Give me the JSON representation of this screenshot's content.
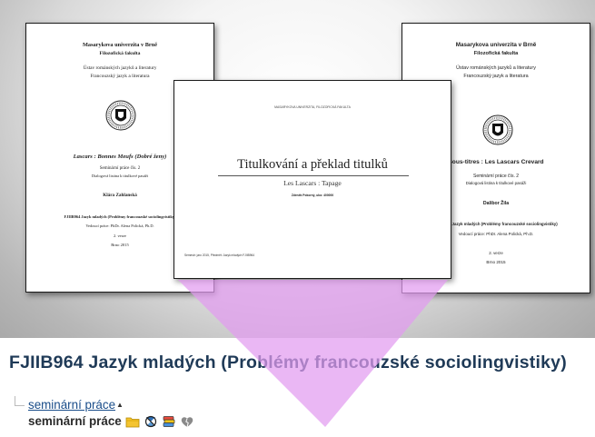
{
  "banner": {
    "left_page": {
      "university": "Masarykova univerzita v Brně",
      "faculty": "Filozofická fakulta",
      "institute": "Ústav románských jazyků a literatury",
      "program": "Francouzský jazyk a literatura",
      "title": "Lascars : Bonnes Meufs (Dobré ženy)",
      "work_type": "Seminární práce čís. 2",
      "subtitle": "Dialogová listina k titulkové pasáži",
      "author": "Klára Zahlanská",
      "course": "FJIIB964 Jazyk mladých (Problémy francouzské sociolingvistiky)",
      "supervisor": "Vedoucí práce: PhDr. Alena Polická, Ph.D.",
      "version": "2. verze",
      "place_date": "Brno 2015"
    },
    "right_page": {
      "university": "Masarykova univerzita v Brně",
      "faculty": "Filozofická fakulta",
      "institute": "Ústav románských jazyků a literatury",
      "program": "Francouzský jazyk a literatura",
      "title": "Sous-titres : Les Lascars Crevard",
      "work_type": "Seminární práce čís. 2",
      "subtitle": "Dialogová listina k titulkové pasáži",
      "author": "Dalibor Žila",
      "course": "FJIIB964 Jazyk mladých (Problémy francouzské sociolingvistiky)",
      "supervisor": "Vedoucí práce: PhDr. Alena Polická, Ph.D.",
      "version": "2. verze",
      "place_date": "Brno 2015"
    },
    "center_page": {
      "header": "MASARYKOVA UNIVERZITA, FILOZOFICKÁ FAKULTA",
      "title": "Titulkování a překlad titulků",
      "subtitle": "Les Lascars : Tapage",
      "author": "Zdeněk Pokorný, uko: 400000",
      "footer": "Semestr: jaro 2015, Předmět: Jazyk mladých FJIIB964"
    }
  },
  "course_heading": "FJIIB964 Jazyk mladých (Problémy francouzské sociolingvistiky)",
  "breadcrumb_link": "seminární práce",
  "folder_label": "seminární práce",
  "icons": [
    "folder-icon",
    "no-access-icon",
    "stacked-files-icon",
    "broken-heart-icon"
  ],
  "colors": {
    "heading": "#1f3a57",
    "link": "#1a4d8a",
    "funnel": "#e4a8f0"
  }
}
